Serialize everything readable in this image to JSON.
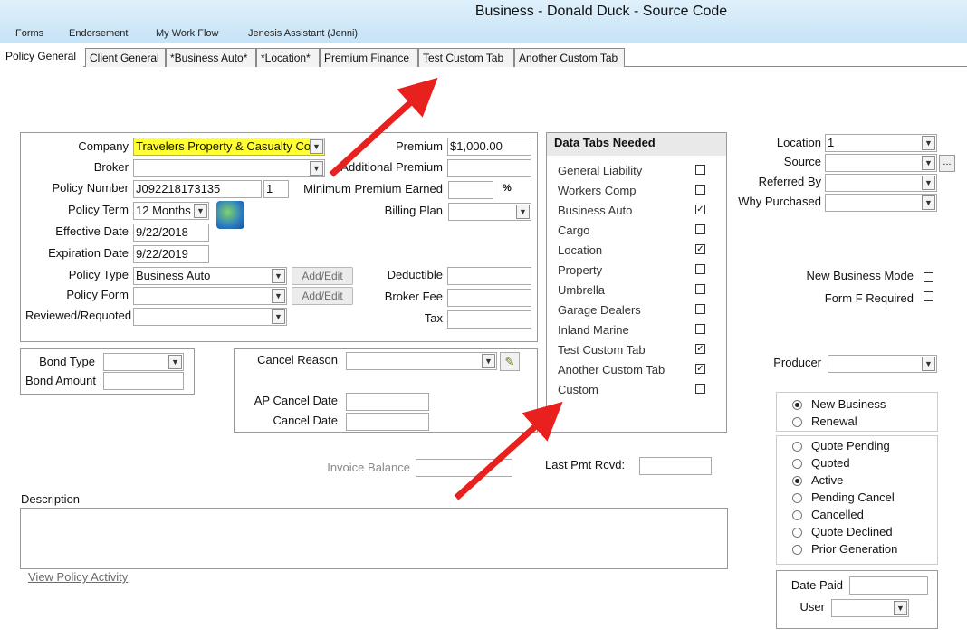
{
  "window": {
    "title": "Business - Donald Duck - Source Code"
  },
  "menu": [
    "Forms",
    "Endorsement",
    "My Work Flow",
    "Jenesis Assistant (Jenni)"
  ],
  "tabs": [
    "Policy General",
    "Client General",
    "*Business Auto*",
    "*Location*",
    "Premium Finance",
    "Test Custom Tab",
    "Another Custom Tab"
  ],
  "policy": {
    "company_label": "Company",
    "company": "Travelers Property & Casualty Co",
    "broker_label": "Broker",
    "broker": "",
    "policy_number_label": "Policy Number",
    "policy_number": "J092218173135",
    "policy_suffix": "1",
    "policy_term_label": "Policy Term",
    "policy_term": "12 Months",
    "effective_date_label": "Effective Date",
    "effective_date": "9/22/2018",
    "expiration_date_label": "Expiration Date",
    "expiration_date": "9/22/2019",
    "policy_type_label": "Policy Type",
    "policy_type": "Business Auto",
    "policy_form_label": "Policy Form",
    "policy_form": "",
    "reviewed_label": "Reviewed/Requoted",
    "reviewed": "",
    "add_edit": "Add/Edit",
    "premium_label": "Premium",
    "premium": "$1,000.00",
    "additional_premium_label": "Additional Premium",
    "additional_premium": "",
    "min_premium_label": "Minimum Premium Earned",
    "min_premium": "",
    "percent": "%",
    "billing_plan_label": "Billing Plan",
    "billing_plan": "",
    "deductible_label": "Deductible",
    "deductible": "",
    "broker_fee_label": "Broker Fee",
    "broker_fee": "",
    "tax_label": "Tax",
    "tax": ""
  },
  "bond": {
    "type_label": "Bond Type",
    "type": "",
    "amount_label": "Bond Amount",
    "amount": ""
  },
  "cancel": {
    "reason_label": "Cancel Reason",
    "reason": "",
    "ap_date_label": "AP Cancel Date",
    "ap_date": "",
    "date_label": "Cancel Date",
    "date": ""
  },
  "invoice_balance_label": "Invoice Balance",
  "invoice_balance": "",
  "last_pmt_label": "Last Pmt Rcvd:",
  "last_pmt": "",
  "description_label": "Description",
  "description": "",
  "view_activity": "View Policy Activity",
  "data_tabs": {
    "title": "Data Tabs Needed",
    "items": [
      {
        "label": "General Liability",
        "checked": false
      },
      {
        "label": "Workers Comp",
        "checked": false
      },
      {
        "label": "Business Auto",
        "checked": true
      },
      {
        "label": "Cargo",
        "checked": false
      },
      {
        "label": "Location",
        "checked": true
      },
      {
        "label": "Property",
        "checked": false
      },
      {
        "label": "Umbrella",
        "checked": false
      },
      {
        "label": "Garage Dealers",
        "checked": false
      },
      {
        "label": "Inland Marine",
        "checked": false
      },
      {
        "label": "Test Custom Tab",
        "checked": true
      },
      {
        "label": "Another Custom Tab",
        "checked": true
      },
      {
        "label": "Custom",
        "checked": false
      }
    ]
  },
  "right": {
    "location_label": "Location",
    "location": "1",
    "source_label": "Source",
    "source": "",
    "ellipsis": "...",
    "referred_by_label": "Referred By",
    "referred_by": "",
    "why_label": "Why Purchased",
    "why": "",
    "new_business_mode_label": "New Business Mode",
    "form_f_label": "Form F Required",
    "producer_label": "Producer",
    "producer": "",
    "business_type": [
      {
        "label": "New Business",
        "selected": true
      },
      {
        "label": "Renewal",
        "selected": false
      }
    ],
    "status": [
      {
        "label": "Quote Pending",
        "selected": false
      },
      {
        "label": "Quoted",
        "selected": false
      },
      {
        "label": "Active",
        "selected": true
      },
      {
        "label": "Pending Cancel",
        "selected": false
      },
      {
        "label": "Cancelled",
        "selected": false
      },
      {
        "label": "Quote Declined",
        "selected": false
      },
      {
        "label": "Prior Generation",
        "selected": false
      }
    ],
    "date_paid_label": "Date Paid",
    "date_paid": "",
    "user_label": "User",
    "user": ""
  },
  "colors": {
    "arrow": "#e8201e",
    "highlight": "#ffff33",
    "titlebar": "#c6e3f6"
  }
}
